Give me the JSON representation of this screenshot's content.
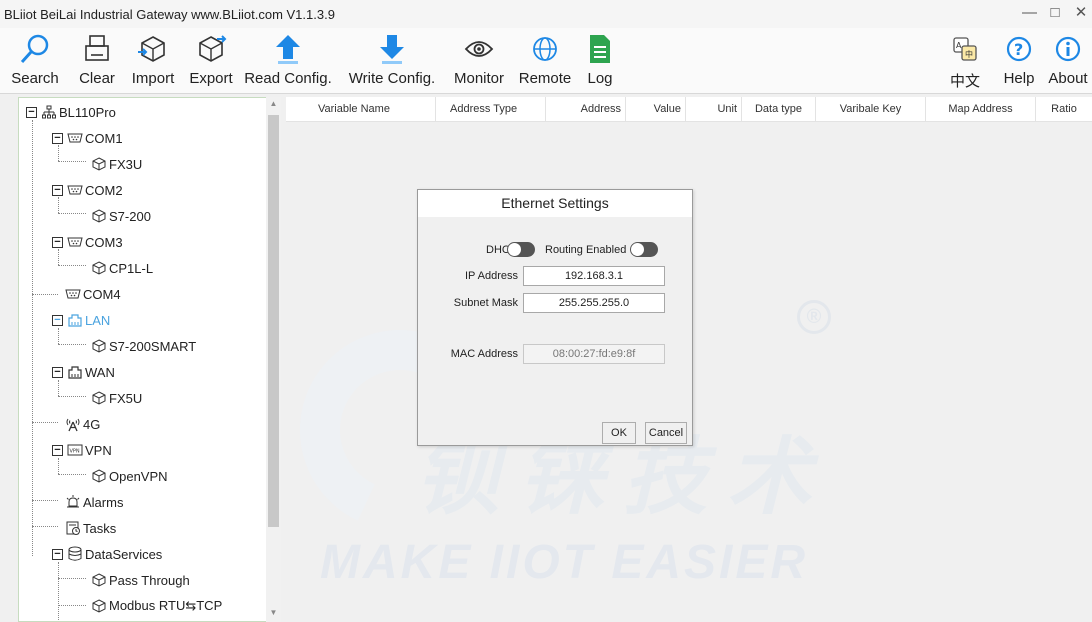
{
  "window": {
    "title": "BLiiot BeiLai Industrial Gateway www.BLiiot.com V1.1.3.9",
    "controls": [
      "—",
      "□",
      "✕"
    ]
  },
  "toolbar": {
    "buttons": [
      {
        "label": "Search",
        "icon": "magnifier-icon"
      },
      {
        "label": "Clear",
        "icon": "printer-icon"
      },
      {
        "label": "Import",
        "icon": "cube-import-icon"
      },
      {
        "label": "Export",
        "icon": "cube-export-icon"
      },
      {
        "label": "Read Config.",
        "icon": "upload-arrow-icon"
      },
      {
        "label": "Write Config.",
        "icon": "download-arrow-icon"
      },
      {
        "label": "Monitor",
        "icon": "eye-icon"
      },
      {
        "label": "Remote",
        "icon": "globe-icon"
      },
      {
        "label": "Log",
        "icon": "document-icon"
      }
    ],
    "right_buttons": [
      {
        "label": "中文",
        "icon": "language-icon"
      },
      {
        "label": "Help",
        "icon": "question-icon"
      },
      {
        "label": "About",
        "icon": "info-icon"
      }
    ]
  },
  "tree": {
    "nodes": [
      {
        "label": "BL110Pro",
        "icon": "network-icon"
      },
      {
        "label": "COM1",
        "icon": "serial-port-icon"
      },
      {
        "label": "FX3U",
        "icon": "device-cube-icon"
      },
      {
        "label": "COM2",
        "icon": "serial-port-icon"
      },
      {
        "label": "S7-200",
        "icon": "device-cube-icon"
      },
      {
        "label": "COM3",
        "icon": "serial-port-icon"
      },
      {
        "label": "CP1L-L",
        "icon": "device-cube-icon"
      },
      {
        "label": "COM4",
        "icon": "serial-port-icon"
      },
      {
        "label": "LAN",
        "icon": "ethernet-icon"
      },
      {
        "label": "S7-200SMART",
        "icon": "device-cube-icon"
      },
      {
        "label": "WAN",
        "icon": "ethernet-icon"
      },
      {
        "label": "FX5U",
        "icon": "device-cube-icon"
      },
      {
        "label": "4G",
        "icon": "antenna-icon"
      },
      {
        "label": "VPN",
        "icon": "vpn-icon"
      },
      {
        "label": "OpenVPN",
        "icon": "device-cube-icon"
      },
      {
        "label": "Alarms",
        "icon": "alarm-icon"
      },
      {
        "label": "Tasks",
        "icon": "tasks-icon"
      },
      {
        "label": "DataServices",
        "icon": "database-icon"
      },
      {
        "label": "Pass Through",
        "icon": "device-cube-icon"
      },
      {
        "label": "Modbus RTU⇆TCP",
        "icon": "device-cube-icon"
      }
    ]
  },
  "table": {
    "columns": [
      "Variable Name",
      "Address Type",
      "Address",
      "Value",
      "Unit",
      "Data type",
      "Varibale Key",
      "Map Address",
      "Ratio"
    ]
  },
  "watermark": {
    "text": "MAKE IIOT EASIER",
    "cn": "钡铼技术",
    "registered": "®"
  },
  "dialog": {
    "title": "Ethernet Settings",
    "dhcp_label": "DHCP",
    "routing_label": "Routing Enabled",
    "ip_label": "IP Address",
    "ip_value": "192.168.3.1",
    "mask_label": "Subnet Mask",
    "mask_value": "255.255.255.0",
    "mac_label": "MAC Address",
    "mac_value": "08:00:27:fd:e9:8f",
    "ok_label": "OK",
    "cancel_label": "Cancel"
  },
  "colors": {
    "accent_blue": "#1e88e5",
    "green_doc": "#2ea44f",
    "lan_selected": "#4aa3df"
  }
}
